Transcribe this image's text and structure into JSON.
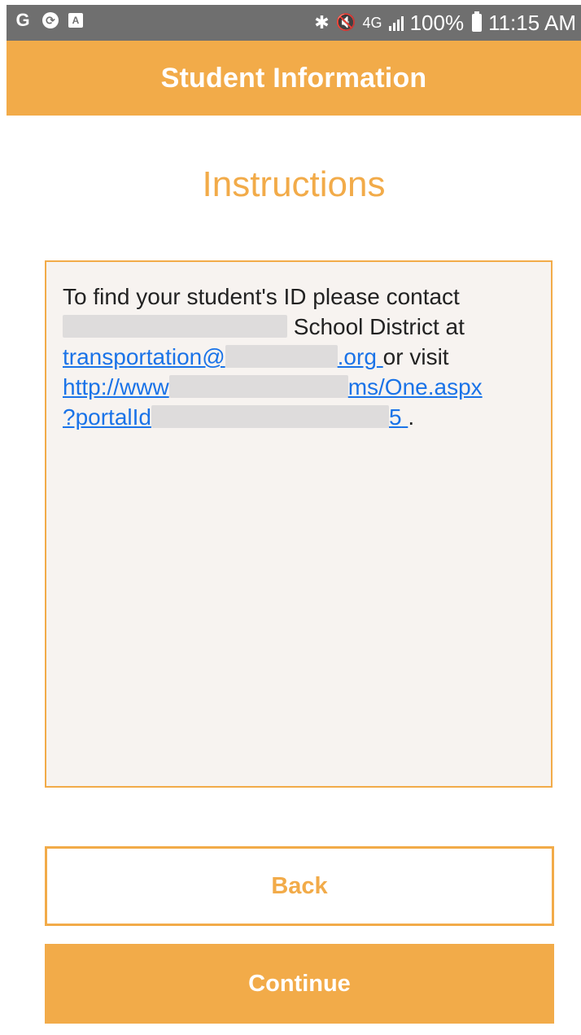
{
  "status_bar": {
    "left_icons": [
      "google-g-icon",
      "sync-icon",
      "a-box-icon"
    ],
    "right": {
      "battery": "100%",
      "time": "11:15 AM",
      "network_label": "4G"
    }
  },
  "header": {
    "title": "Student Information"
  },
  "main": {
    "section_title": "Instructions",
    "instructions": {
      "line1": "To find your student's ID please contact",
      "district_suffix": "School District at",
      "email_prefix": "transportation@",
      "email_suffix": ".org",
      "or_visit": "or visit",
      "url_part1": "http://www",
      "url_part2": "ms/One.aspx",
      "url_part3": "?portalId",
      "url_tail": "5",
      "trailing_period": "."
    }
  },
  "buttons": {
    "back_label": "Back",
    "continue_label": "Continue"
  },
  "colors": {
    "accent": "#f2ab49",
    "status_bar_bg": "#6f6f6f",
    "link": "#1a73e8",
    "box_bg": "#f7f3f0"
  }
}
